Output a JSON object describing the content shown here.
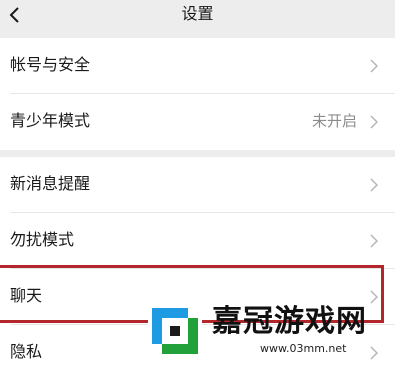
{
  "header": {
    "title": "设置",
    "back_icon": "chevron-left-icon"
  },
  "group1": [
    {
      "label": "帐号与安全",
      "value": ""
    },
    {
      "label": "青少年模式",
      "value": "未开启"
    }
  ],
  "group2": [
    {
      "label": "新消息提醒",
      "value": ""
    },
    {
      "label": "勿扰模式",
      "value": ""
    },
    {
      "label": "聊天",
      "value": ""
    },
    {
      "label": "隐私",
      "value": ""
    }
  ],
  "highlight_color": "#b3262b",
  "watermark": {
    "text": "嘉冠游戏网",
    "url": "www.03mm.net"
  }
}
